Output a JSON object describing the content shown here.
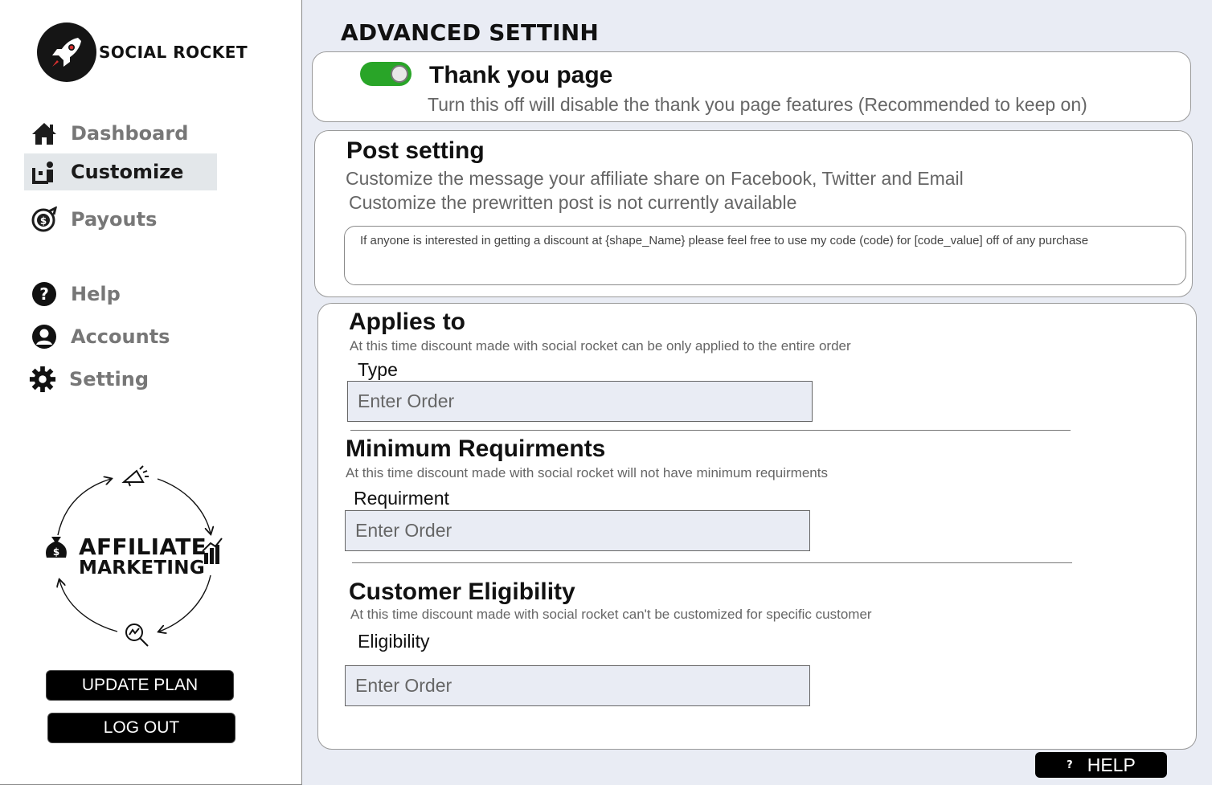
{
  "brand": {
    "name": "SOCIAL ROCKET",
    "logo_icon": "rocket-icon"
  },
  "sidebar": {
    "nav": [
      {
        "label": "Dashboard",
        "icon": "home-icon",
        "active": false
      },
      {
        "label": "Customize",
        "icon": "customize-icon",
        "active": true
      },
      {
        "label": "Payouts",
        "icon": "payouts-icon",
        "active": false
      },
      {
        "label": "Help",
        "icon": "help-icon",
        "active": false
      },
      {
        "label": "Accounts",
        "icon": "account-icon",
        "active": false
      },
      {
        "label": "Setting",
        "icon": "gear-icon",
        "active": false
      }
    ],
    "graphic": {
      "line1": "AFFILIATE",
      "line2": "MARKETING"
    },
    "update_plan": "UPDATE PLAN",
    "log_out": "LOG OUT"
  },
  "page": {
    "title": "ADVANCED SETTINH"
  },
  "thank_you": {
    "title": "Thank you page",
    "description": "Turn this off will disable the thank you page features (Recommended to keep on)",
    "enabled": true,
    "accent_color": "#29a528"
  },
  "post_setting": {
    "title": "Post setting",
    "description1": "Customize the message your affiliate share on Facebook, Twitter and Email",
    "description2": "Customize the prewritten post is not currently available",
    "message": "If anyone is interested in getting a discount at {shape_Name}  please feel free to use my code (code) for [code_value] off of any purchase"
  },
  "applies_to": {
    "title": "Applies to",
    "description": "At this time discount made with social rocket can be only applied to the entire order",
    "field_label": "Type",
    "placeholder": "Enter Order"
  },
  "minimum": {
    "title": "Minimum Requirments",
    "description": "At this time discount made with social rocket will not have minimum requirments",
    "field_label": "Requirment",
    "placeholder": "Enter Order"
  },
  "eligibility": {
    "title": "Customer Eligibility",
    "description": "At this time discount made with social rocket can't be customized for specific customer",
    "field_label": "Eligibility",
    "placeholder": "Enter Order"
  },
  "help_button": {
    "icon": "?",
    "label": "HELP"
  }
}
